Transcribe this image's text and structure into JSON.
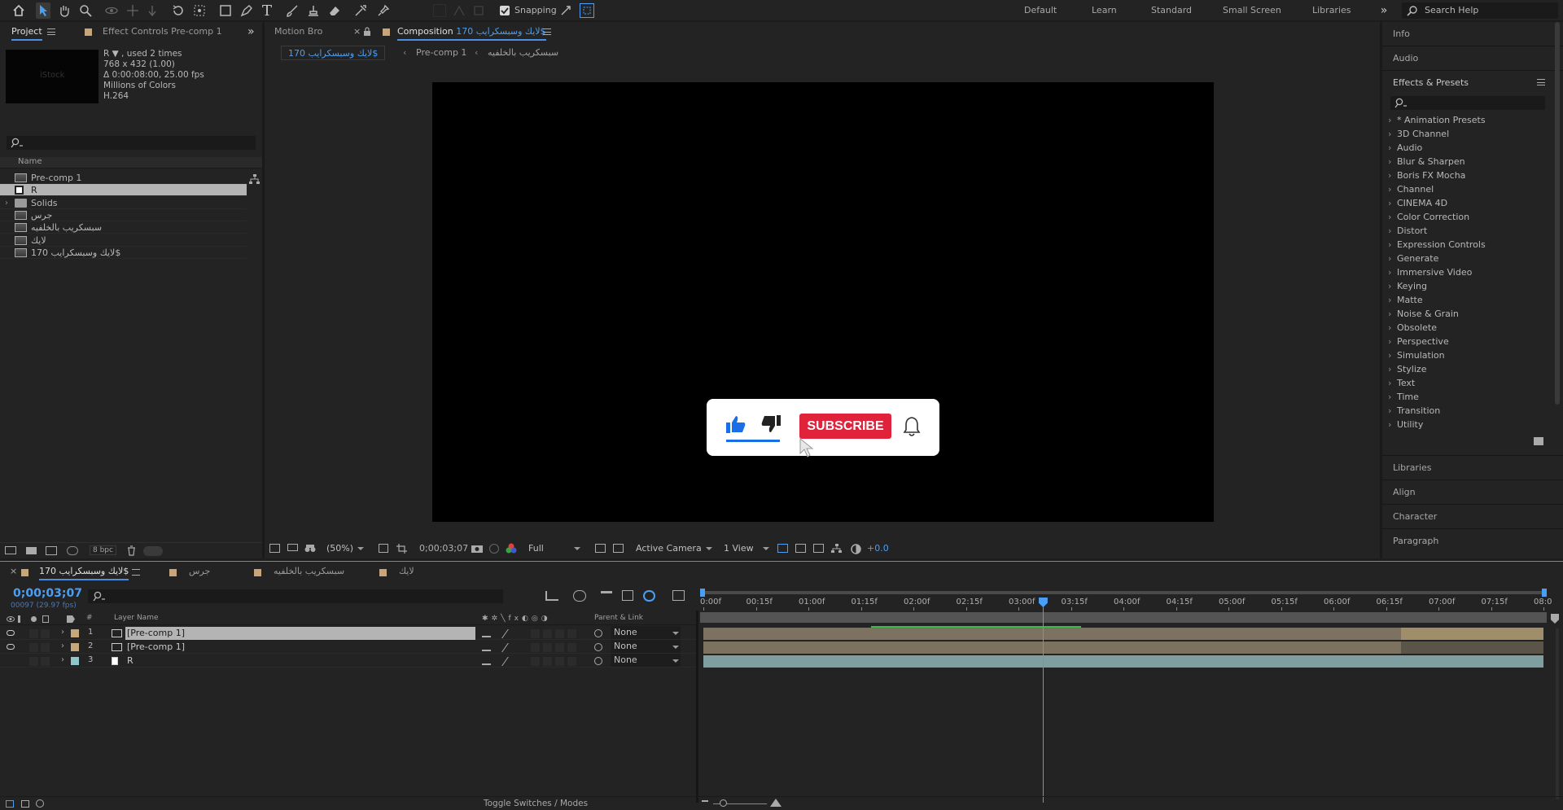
{
  "toolbar": {
    "snapping_label": "Snapping",
    "workspaces": [
      "Default",
      "Learn",
      "Standard",
      "Small Screen",
      "Libraries"
    ],
    "search_placeholder": "Search Help"
  },
  "project_panel": {
    "tab_project": "Project",
    "tab_effect_controls": "Effect Controls Pre-comp 1",
    "thumb_text": "iStock",
    "info_lines": [
      "R ▼ , used 2 times",
      "768 x 432 (1.00)",
      "Δ 0:00:08:00, 25.00 fps",
      "Millions of Colors",
      "H.264"
    ],
    "column_name": "Name",
    "items": [
      {
        "name": "Pre-comp 1",
        "type": "comp"
      },
      {
        "name": "R",
        "type": "footage",
        "selected": true
      },
      {
        "name": "Solids",
        "type": "folder"
      },
      {
        "name": "جرس",
        "type": "comp"
      },
      {
        "name": "سبسكريب بالخلفيه",
        "type": "comp"
      },
      {
        "name": "لايك",
        "type": "comp"
      },
      {
        "name": "170 لايك وسبسكرايب$",
        "type": "comp"
      }
    ],
    "bpc_label": "8 bpc"
  },
  "viewer": {
    "tab_motion_bro": "Motion Bro",
    "tab_composition_prefix": "Composition",
    "tab_composition_name": "170 لايك وسبسكرايب$",
    "breadcrumbs": [
      "170 لايك وسبسكرايب$",
      "Pre-comp 1",
      "سبسكريب بالخلفيه"
    ],
    "subscribe_label": "SUBSCRIBE",
    "footer": {
      "zoom": "(50%)",
      "timecode": "0;00;03;07",
      "resolution": "Full",
      "camera": "Active Camera",
      "views": "1 View",
      "exposure": "+0.0"
    }
  },
  "effects_panel": {
    "info": "Info",
    "audio": "Audio",
    "title": "Effects & Presets",
    "items": [
      "* Animation Presets",
      "3D Channel",
      "Audio",
      "Blur & Sharpen",
      "Boris FX Mocha",
      "Channel",
      "CINEMA 4D",
      "Color Correction",
      "Distort",
      "Expression Controls",
      "Generate",
      "Immersive Video",
      "Keying",
      "Matte",
      "Noise & Grain",
      "Obsolete",
      "Perspective",
      "Simulation",
      "Stylize",
      "Text",
      "Time",
      "Transition",
      "Utility"
    ],
    "collapsed_panels": [
      "Libraries",
      "Align",
      "Character",
      "Paragraph"
    ]
  },
  "timeline": {
    "tabs": [
      {
        "name": "170 لايك وسبسكرايب$",
        "color": "#c7a77a",
        "active": true
      },
      {
        "name": "جرس",
        "color": "#c7a77a"
      },
      {
        "name": "سبسكريب بالخلفيه",
        "color": "#c7a77a"
      },
      {
        "name": "لايك",
        "color": "#c7a77a"
      }
    ],
    "timecode": "0;00;03;07",
    "frames": "00097 (29.97 fps)",
    "col_layer_name": "Layer Name",
    "col_parent": "Parent & Link",
    "layers": [
      {
        "num": "1",
        "name": "[Pre-comp 1]",
        "color": "#c7a77a",
        "parent": "None",
        "selected": true
      },
      {
        "num": "2",
        "name": "[Pre-comp 1]",
        "color": "#c7a77a",
        "parent": "None"
      },
      {
        "num": "3",
        "name": "R",
        "color": "#8fc6c8",
        "parent": "None"
      }
    ],
    "ruler": [
      "0:00f",
      "00:15f",
      "01:00f",
      "01:15f",
      "02:00f",
      "02:15f",
      "03:00f",
      "03:15f",
      "04:00f",
      "04:15f",
      "05:00f",
      "05:15f",
      "06:00f",
      "06:15f",
      "07:00f",
      "07:15f",
      "08:0"
    ],
    "playhead_fraction": 0.404,
    "toggle_label": "Toggle Switches / Modes"
  },
  "colors": {
    "accent": "#4a90e2",
    "subscribe_red": "#e0233a",
    "like_blue": "#1a6ee8"
  }
}
